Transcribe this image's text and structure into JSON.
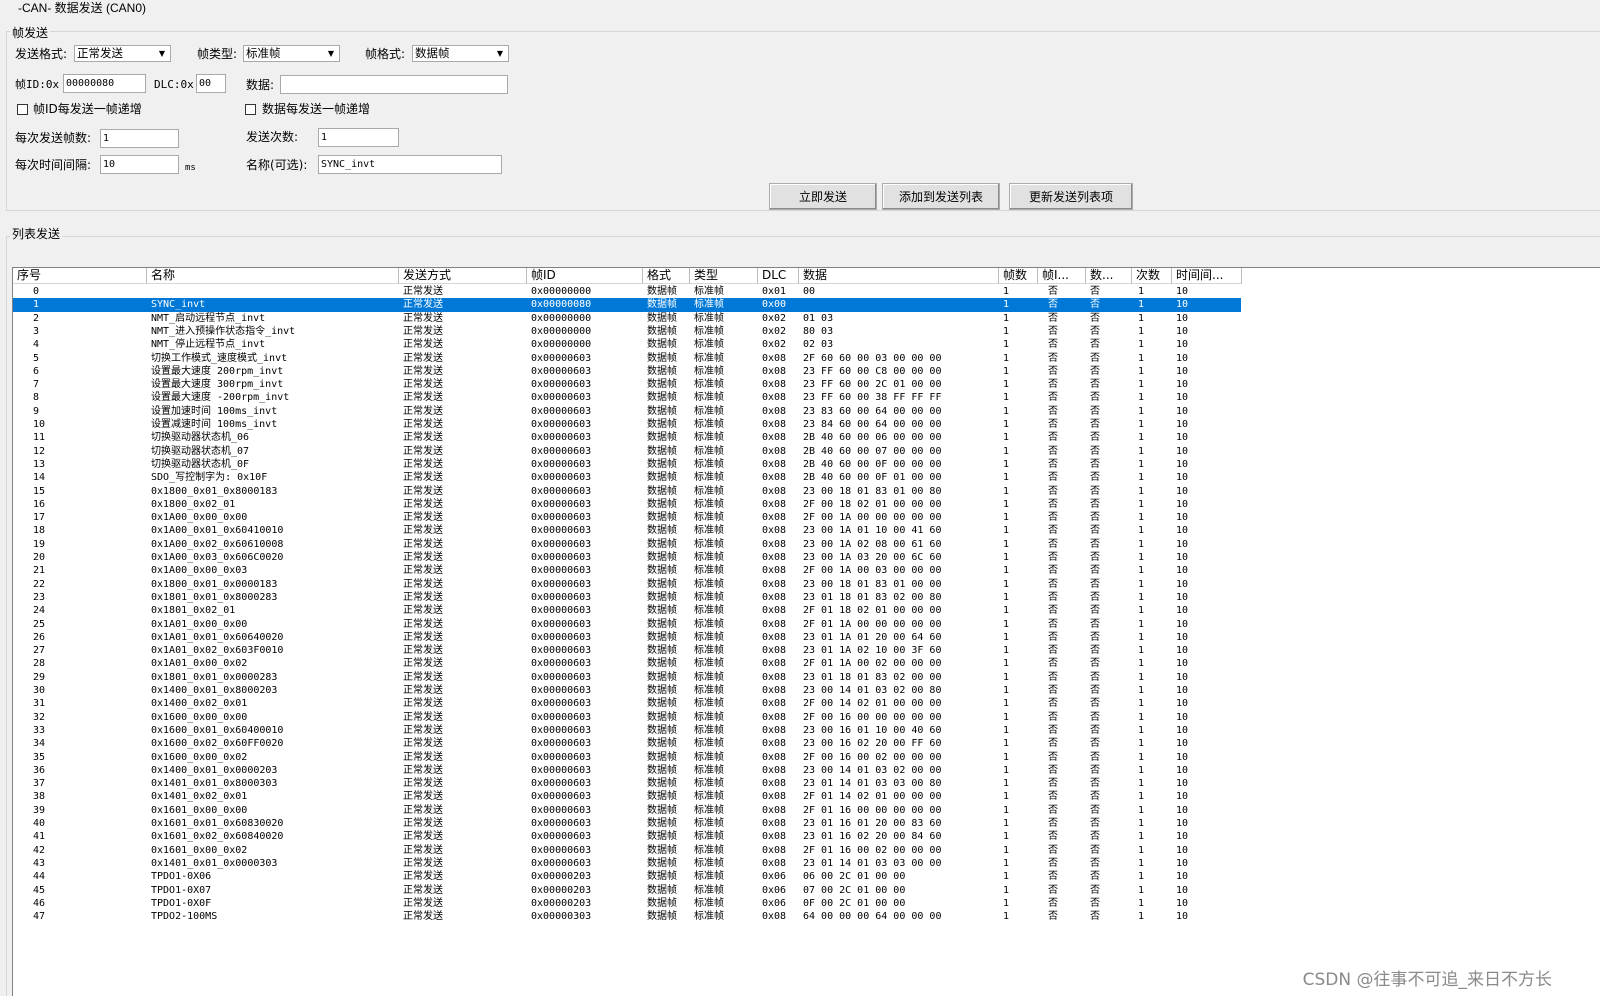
{
  "window": {
    "title": "-CAN- 数据发送 (CAN0)"
  },
  "frame_send": {
    "legend": "帧发送",
    "send_format_label": "发送格式:",
    "send_format_value": "正常发送",
    "frame_type_label": "帧类型:",
    "frame_type_value": "标准帧",
    "frame_format_label": "帧格式:",
    "frame_format_value": "数据帧",
    "frame_id_label": "帧ID:0x",
    "frame_id_value": "00000080",
    "dlc_label": "DLC:0x",
    "dlc_value": "00",
    "data_label": "数据:",
    "data_value": "",
    "frame_id_increment_label": "帧ID每发送一帧递增",
    "data_increment_label": "数据每发送一帧递增",
    "frames_per_send_label": "每次发送帧数:",
    "frames_per_send_value": "1",
    "send_count_label": "发送次数:",
    "send_count_value": "1",
    "interval_label": "每次时间间隔:",
    "interval_value": "10",
    "interval_unit": "ms",
    "name_label": "名称(可选):",
    "name_value": "SYNC_invt",
    "send_now_button": "立即发送",
    "add_to_list_button": "添加到发送列表",
    "update_list_button": "更新发送列表项"
  },
  "list_send": {
    "legend": "列表发送",
    "columns": [
      "序号",
      "名称",
      "发送方式",
      "帧ID",
      "格式",
      "类型",
      "DLC",
      "数据",
      "帧数",
      "帧I...",
      "数...",
      "次数",
      "时间间..."
    ],
    "selected_index": 1,
    "rows": [
      [
        "0",
        "",
        "正常发送",
        "0x00000000",
        "数据帧",
        "标准帧",
        "0x01",
        "00",
        "1",
        "否",
        "否",
        "1",
        "10"
      ],
      [
        "1",
        "SYNC_invt",
        "正常发送",
        "0x00000080",
        "数据帧",
        "标准帧",
        "0x00",
        "",
        "1",
        "否",
        "否",
        "1",
        "10"
      ],
      [
        "2",
        "NMT_启动远程节点_invt",
        "正常发送",
        "0x00000000",
        "数据帧",
        "标准帧",
        "0x02",
        "01 03",
        "1",
        "否",
        "否",
        "1",
        "10"
      ],
      [
        "3",
        "NMT_进入预操作状态指令_invt",
        "正常发送",
        "0x00000000",
        "数据帧",
        "标准帧",
        "0x02",
        "80 03",
        "1",
        "否",
        "否",
        "1",
        "10"
      ],
      [
        "4",
        "NMT_停止远程节点_invt",
        "正常发送",
        "0x00000000",
        "数据帧",
        "标准帧",
        "0x02",
        "02 03",
        "1",
        "否",
        "否",
        "1",
        "10"
      ],
      [
        "5",
        "切换工作模式_速度模式_invt",
        "正常发送",
        "0x00000603",
        "数据帧",
        "标准帧",
        "0x08",
        "2F 60 60 00 03 00 00 00",
        "1",
        "否",
        "否",
        "1",
        "10"
      ],
      [
        "6",
        "设置最大速度 200rpm_invt",
        "正常发送",
        "0x00000603",
        "数据帧",
        "标准帧",
        "0x08",
        "23 FF 60 00 C8 00 00 00",
        "1",
        "否",
        "否",
        "1",
        "10"
      ],
      [
        "7",
        "设置最大速度 300rpm_invt",
        "正常发送",
        "0x00000603",
        "数据帧",
        "标准帧",
        "0x08",
        "23 FF 60 00 2C 01 00 00",
        "1",
        "否",
        "否",
        "1",
        "10"
      ],
      [
        "8",
        "设置最大速度 -200rpm_invt",
        "正常发送",
        "0x00000603",
        "数据帧",
        "标准帧",
        "0x08",
        "23 FF 60 00 38 FF FF FF",
        "1",
        "否",
        "否",
        "1",
        "10"
      ],
      [
        "9",
        "设置加速时间 100ms_invt",
        "正常发送",
        "0x00000603",
        "数据帧",
        "标准帧",
        "0x08",
        "23 83 60 00 64 00 00 00",
        "1",
        "否",
        "否",
        "1",
        "10"
      ],
      [
        "10",
        "设置减速时间 100ms_invt",
        "正常发送",
        "0x00000603",
        "数据帧",
        "标准帧",
        "0x08",
        "23 84 60 00 64 00 00 00",
        "1",
        "否",
        "否",
        "1",
        "10"
      ],
      [
        "11",
        "切换驱动器状态机_06",
        "正常发送",
        "0x00000603",
        "数据帧",
        "标准帧",
        "0x08",
        "2B 40 60 00 06 00 00 00",
        "1",
        "否",
        "否",
        "1",
        "10"
      ],
      [
        "12",
        "切换驱动器状态机_07",
        "正常发送",
        "0x00000603",
        "数据帧",
        "标准帧",
        "0x08",
        "2B 40 60 00 07 00 00 00",
        "1",
        "否",
        "否",
        "1",
        "10"
      ],
      [
        "13",
        "切换驱动器状态机_0F",
        "正常发送",
        "0x00000603",
        "数据帧",
        "标准帧",
        "0x08",
        "2B 40 60 00 0F 00 00 00",
        "1",
        "否",
        "否",
        "1",
        "10"
      ],
      [
        "14",
        "SDO_写控制字为: 0x10F",
        "正常发送",
        "0x00000603",
        "数据帧",
        "标准帧",
        "0x08",
        "2B 40 60 00 0F 01 00 00",
        "1",
        "否",
        "否",
        "1",
        "10"
      ],
      [
        "15",
        "0x1800_0x01_0x8000183",
        "正常发送",
        "0x00000603",
        "数据帧",
        "标准帧",
        "0x08",
        "23 00 18 01 83 01 00 80",
        "1",
        "否",
        "否",
        "1",
        "10"
      ],
      [
        "16",
        "0x1800_0x02_01",
        "正常发送",
        "0x00000603",
        "数据帧",
        "标准帧",
        "0x08",
        "2F 00 18 02 01 00 00 00",
        "1",
        "否",
        "否",
        "1",
        "10"
      ],
      [
        "17",
        "0x1A00_0x00_0x00",
        "正常发送",
        "0x00000603",
        "数据帧",
        "标准帧",
        "0x08",
        "2F 00 1A 00 00 00 00 00",
        "1",
        "否",
        "否",
        "1",
        "10"
      ],
      [
        "18",
        "0x1A00_0x01_0x60410010",
        "正常发送",
        "0x00000603",
        "数据帧",
        "标准帧",
        "0x08",
        "23 00 1A 01 10 00 41 60",
        "1",
        "否",
        "否",
        "1",
        "10"
      ],
      [
        "19",
        "0x1A00_0x02_0x60610008",
        "正常发送",
        "0x00000603",
        "数据帧",
        "标准帧",
        "0x08",
        "23 00 1A 02 08 00 61 60",
        "1",
        "否",
        "否",
        "1",
        "10"
      ],
      [
        "20",
        "0x1A00_0x03_0x606C0020",
        "正常发送",
        "0x00000603",
        "数据帧",
        "标准帧",
        "0x08",
        "23 00 1A 03 20 00 6C 60",
        "1",
        "否",
        "否",
        "1",
        "10"
      ],
      [
        "21",
        "0x1A00_0x00_0x03",
        "正常发送",
        "0x00000603",
        "数据帧",
        "标准帧",
        "0x08",
        "2F 00 1A 00 03 00 00 00",
        "1",
        "否",
        "否",
        "1",
        "10"
      ],
      [
        "22",
        "0x1800_0x01_0x0000183",
        "正常发送",
        "0x00000603",
        "数据帧",
        "标准帧",
        "0x08",
        "23 00 18 01 83 01 00 00",
        "1",
        "否",
        "否",
        "1",
        "10"
      ],
      [
        "23",
        "0x1801_0x01_0x8000283",
        "正常发送",
        "0x00000603",
        "数据帧",
        "标准帧",
        "0x08",
        "23 01 18 01 83 02 00 80",
        "1",
        "否",
        "否",
        "1",
        "10"
      ],
      [
        "24",
        "0x1801_0x02_01",
        "正常发送",
        "0x00000603",
        "数据帧",
        "标准帧",
        "0x08",
        "2F 01 18 02 01 00 00 00",
        "1",
        "否",
        "否",
        "1",
        "10"
      ],
      [
        "25",
        "0x1A01_0x00_0x00",
        "正常发送",
        "0x00000603",
        "数据帧",
        "标准帧",
        "0x08",
        "2F 01 1A 00 00 00 00 00",
        "1",
        "否",
        "否",
        "1",
        "10"
      ],
      [
        "26",
        "0x1A01_0x01_0x60640020",
        "正常发送",
        "0x00000603",
        "数据帧",
        "标准帧",
        "0x08",
        "23 01 1A 01 20 00 64 60",
        "1",
        "否",
        "否",
        "1",
        "10"
      ],
      [
        "27",
        "0x1A01_0x02_0x603F0010",
        "正常发送",
        "0x00000603",
        "数据帧",
        "标准帧",
        "0x08",
        "23 01 1A 02 10 00 3F 60",
        "1",
        "否",
        "否",
        "1",
        "10"
      ],
      [
        "28",
        "0x1A01_0x00_0x02",
        "正常发送",
        "0x00000603",
        "数据帧",
        "标准帧",
        "0x08",
        "2F 01 1A 00 02 00 00 00",
        "1",
        "否",
        "否",
        "1",
        "10"
      ],
      [
        "29",
        "0x1801_0x01_0x0000283",
        "正常发送",
        "0x00000603",
        "数据帧",
        "标准帧",
        "0x08",
        "23 01 18 01 83 02 00 00",
        "1",
        "否",
        "否",
        "1",
        "10"
      ],
      [
        "30",
        "0x1400_0x01_0x8000203",
        "正常发送",
        "0x00000603",
        "数据帧",
        "标准帧",
        "0x08",
        "23 00 14 01 03 02 00 80",
        "1",
        "否",
        "否",
        "1",
        "10"
      ],
      [
        "31",
        "0x1400_0x02_0x01",
        "正常发送",
        "0x00000603",
        "数据帧",
        "标准帧",
        "0x08",
        "2F 00 14 02 01 00 00 00",
        "1",
        "否",
        "否",
        "1",
        "10"
      ],
      [
        "32",
        "0x1600_0x00_0x00",
        "正常发送",
        "0x00000603",
        "数据帧",
        "标准帧",
        "0x08",
        "2F 00 16 00 00 00 00 00",
        "1",
        "否",
        "否",
        "1",
        "10"
      ],
      [
        "33",
        "0x1600_0x01_0x60400010",
        "正常发送",
        "0x00000603",
        "数据帧",
        "标准帧",
        "0x08",
        "23 00 16 01 10 00 40 60",
        "1",
        "否",
        "否",
        "1",
        "10"
      ],
      [
        "34",
        "0x1600_0x02_0x60FF0020",
        "正常发送",
        "0x00000603",
        "数据帧",
        "标准帧",
        "0x08",
        "23 00 16 02 20 00 FF 60",
        "1",
        "否",
        "否",
        "1",
        "10"
      ],
      [
        "35",
        "0x1600_0x00_0x02",
        "正常发送",
        "0x00000603",
        "数据帧",
        "标准帧",
        "0x08",
        "2F 00 16 00 02 00 00 00",
        "1",
        "否",
        "否",
        "1",
        "10"
      ],
      [
        "36",
        "0x1400_0x01_0x0000203",
        "正常发送",
        "0x00000603",
        "数据帧",
        "标准帧",
        "0x08",
        "23 00 14 01 03 02 00 00",
        "1",
        "否",
        "否",
        "1",
        "10"
      ],
      [
        "37",
        "0x1401_0x01_0x8000303",
        "正常发送",
        "0x00000603",
        "数据帧",
        "标准帧",
        "0x08",
        "23 01 14 01 03 03 00 80",
        "1",
        "否",
        "否",
        "1",
        "10"
      ],
      [
        "38",
        "0x1401_0x02_0x01",
        "正常发送",
        "0x00000603",
        "数据帧",
        "标准帧",
        "0x08",
        "2F 01 14 02 01 00 00 00",
        "1",
        "否",
        "否",
        "1",
        "10"
      ],
      [
        "39",
        "0x1601_0x00_0x00",
        "正常发送",
        "0x00000603",
        "数据帧",
        "标准帧",
        "0x08",
        "2F 01 16 00 00 00 00 00",
        "1",
        "否",
        "否",
        "1",
        "10"
      ],
      [
        "40",
        "0x1601_0x01_0x60830020",
        "正常发送",
        "0x00000603",
        "数据帧",
        "标准帧",
        "0x08",
        "23 01 16 01 20 00 83 60",
        "1",
        "否",
        "否",
        "1",
        "10"
      ],
      [
        "41",
        "0x1601_0x02_0x60840020",
        "正常发送",
        "0x00000603",
        "数据帧",
        "标准帧",
        "0x08",
        "23 01 16 02 20 00 84 60",
        "1",
        "否",
        "否",
        "1",
        "10"
      ],
      [
        "42",
        "0x1601_0x00_0x02",
        "正常发送",
        "0x00000603",
        "数据帧",
        "标准帧",
        "0x08",
        "2F 01 16 00 02 00 00 00",
        "1",
        "否",
        "否",
        "1",
        "10"
      ],
      [
        "43",
        "0x1401_0x01_0x0000303",
        "正常发送",
        "0x00000603",
        "数据帧",
        "标准帧",
        "0x08",
        "23 01 14 01 03 03 00 00",
        "1",
        "否",
        "否",
        "1",
        "10"
      ],
      [
        "44",
        "TPDO1-0X06",
        "正常发送",
        "0x00000203",
        "数据帧",
        "标准帧",
        "0x06",
        "06 00 2C 01 00 00",
        "1",
        "否",
        "否",
        "1",
        "10"
      ],
      [
        "45",
        "TPDO1-0X07",
        "正常发送",
        "0x00000203",
        "数据帧",
        "标准帧",
        "0x06",
        "07 00 2C 01 00 00",
        "1",
        "否",
        "否",
        "1",
        "10"
      ],
      [
        "46",
        "TPDO1-0X0F",
        "正常发送",
        "0x00000203",
        "数据帧",
        "标准帧",
        "0x06",
        "0F 00 2C 01 00 00",
        "1",
        "否",
        "否",
        "1",
        "10"
      ],
      [
        "47",
        "TPDO2-100MS",
        "正常发送",
        "0x00000303",
        "数据帧",
        "标准帧",
        "0x08",
        "64 00 00 00 64 00 00 00",
        "1",
        "否",
        "否",
        "1",
        "10"
      ]
    ]
  },
  "watermark": "CSDN @往事不可追_来日不方长",
  "colors": {
    "selection": "#0078d7",
    "background": "#f0f0f0"
  }
}
